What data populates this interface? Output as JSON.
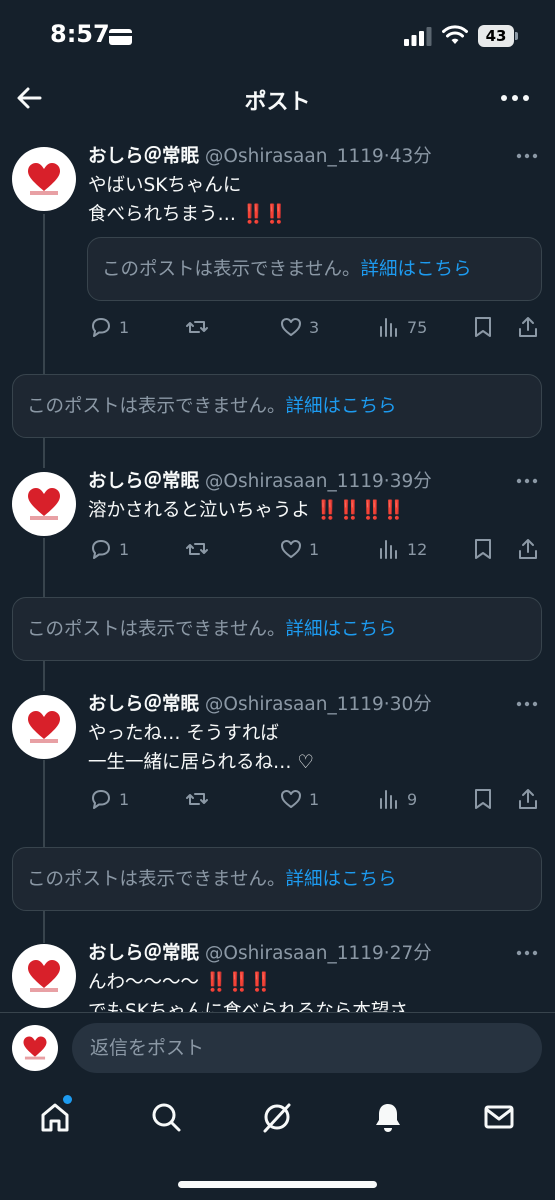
{
  "status": {
    "time": "8:57",
    "battery": "43"
  },
  "nav": {
    "title": "ポスト"
  },
  "posts": [
    {
      "name": "おしら＠常眠",
      "handle": "@Oshirasaan_1119",
      "time": "43分",
      "lines": [
        "やばいSKちゃんに",
        "食べられちまう…"
      ],
      "emoji": "‼️‼️",
      "quote_text": "このポストは表示できません。",
      "quote_link": "詳細はこちら",
      "replies": "1",
      "reposts": "",
      "likes": "3",
      "views": "75"
    },
    {
      "name": "おしら＠常眠",
      "handle": "@Oshirasaan_1119",
      "time": "39分",
      "lines": [
        "溶かされると泣いちゃうよ"
      ],
      "emoji": "‼️‼️‼️‼️",
      "replies": "1",
      "reposts": "",
      "likes": "1",
      "views": "12"
    },
    {
      "name": "おしら＠常眠",
      "handle": "@Oshirasaan_1119",
      "time": "30分",
      "lines": [
        "やったね… そうすれば",
        "一生一緒に居られるね… ♡"
      ],
      "replies": "1",
      "reposts": "",
      "likes": "1",
      "views": "9"
    },
    {
      "name": "おしら＠常眠",
      "handle": "@Oshirasaan_1119",
      "time": "27分",
      "lines": [
        "んわ〜〜〜〜",
        "でもSKちゃんに食べられるなら本望さ"
      ],
      "emoji": "‼️‼️‼️"
    }
  ],
  "notices": [
    {
      "text": "このポストは表示できません。",
      "link": "詳細はこちら"
    },
    {
      "text": "このポストは表示できません。",
      "link": "詳細はこちら"
    },
    {
      "text": "このポストは表示できません。",
      "link": "詳細はこちら"
    }
  ],
  "reply": {
    "placeholder": "返信をポスト"
  },
  "tabs": [
    "home-icon",
    "search-icon",
    "grok-icon",
    "notifications-icon",
    "messages-icon"
  ],
  "colors": {
    "background": "#15202b",
    "accent": "#1d9bf0",
    "muted": "#8b98a5",
    "emoji_red": "#e0191b"
  }
}
